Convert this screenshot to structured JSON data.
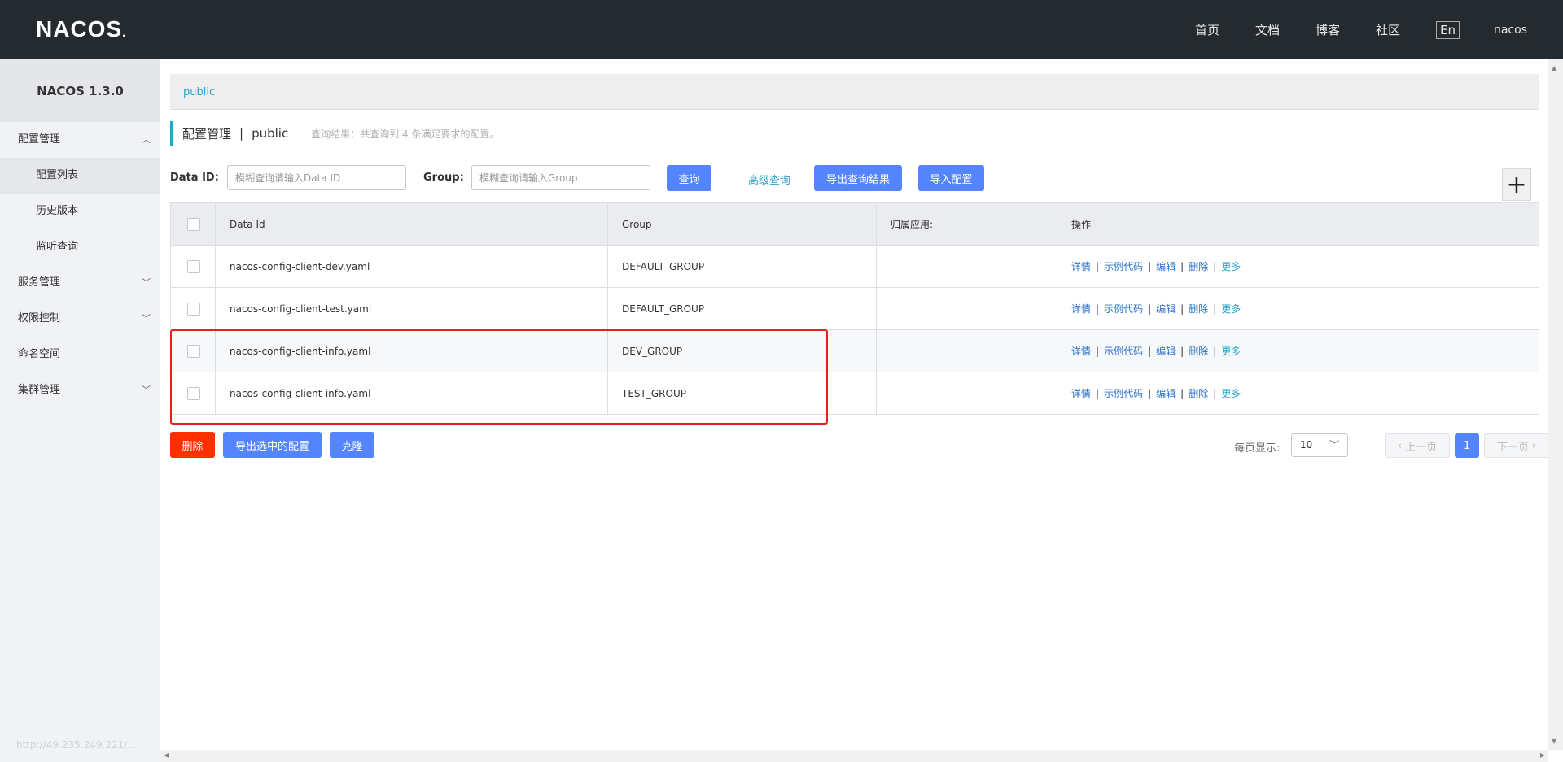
{
  "header": {
    "logo": "NACOS",
    "nav": [
      "首页",
      "文档",
      "博客",
      "社区"
    ],
    "lang": "En",
    "user": "nacos"
  },
  "sidebar": {
    "title": "NACOS 1.3.0",
    "items": [
      {
        "label": "配置管理",
        "type": "group",
        "expanded": true
      },
      {
        "label": "配置列表",
        "type": "sub",
        "active": true
      },
      {
        "label": "历史版本",
        "type": "sub"
      },
      {
        "label": "监听查询",
        "type": "sub"
      },
      {
        "label": "服务管理",
        "type": "group",
        "expanded": false
      },
      {
        "label": "权限控制",
        "type": "group",
        "expanded": false
      },
      {
        "label": "命名空间",
        "type": "link"
      },
      {
        "label": "集群管理",
        "type": "group",
        "expanded": false
      }
    ],
    "url_hint": "http://49.235.249.221/..."
  },
  "breadcrumb": {
    "namespace": "public"
  },
  "title": {
    "main": "配置管理",
    "sep": "|",
    "namespace": "public",
    "hint": "查询结果：共查询到 4 条满足要求的配置。"
  },
  "filter": {
    "dataid_label": "Data ID:",
    "dataid_placeholder": "模糊查询请输入Data ID",
    "group_label": "Group:",
    "group_placeholder": "模糊查询请输入Group",
    "query_btn": "查询",
    "advanced": "高级查询",
    "export_btn": "导出查询结果",
    "import_btn": "导入配置",
    "add_icon": "plus-icon"
  },
  "table": {
    "headers": [
      "Data Id",
      "Group",
      "归属应用:",
      "操作"
    ],
    "rows": [
      {
        "data_id": "nacos-config-client-dev.yaml",
        "group": "DEFAULT_GROUP",
        "app": ""
      },
      {
        "data_id": "nacos-config-client-test.yaml",
        "group": "DEFAULT_GROUP",
        "app": ""
      },
      {
        "data_id": "nacos-config-client-info.yaml",
        "group": "DEV_GROUP",
        "app": ""
      },
      {
        "data_id": "nacos-config-client-info.yaml",
        "group": "TEST_GROUP",
        "app": ""
      }
    ],
    "ops": [
      "详情",
      "示例代码",
      "编辑",
      "删除",
      "更多"
    ],
    "highlight_color": "#e2231a"
  },
  "footer": {
    "delete_btn": "删除",
    "export_selected_btn": "导出选中的配置",
    "clone_btn": "克隆",
    "page_size_label": "每页显示:",
    "page_size": "10",
    "prev": "上一页",
    "current_page": "1",
    "next": "下一页"
  },
  "colors": {
    "primary": "#5584ff",
    "danger": "#ff3000",
    "link": "#2ba3c9",
    "topbar": "#252a2f"
  }
}
